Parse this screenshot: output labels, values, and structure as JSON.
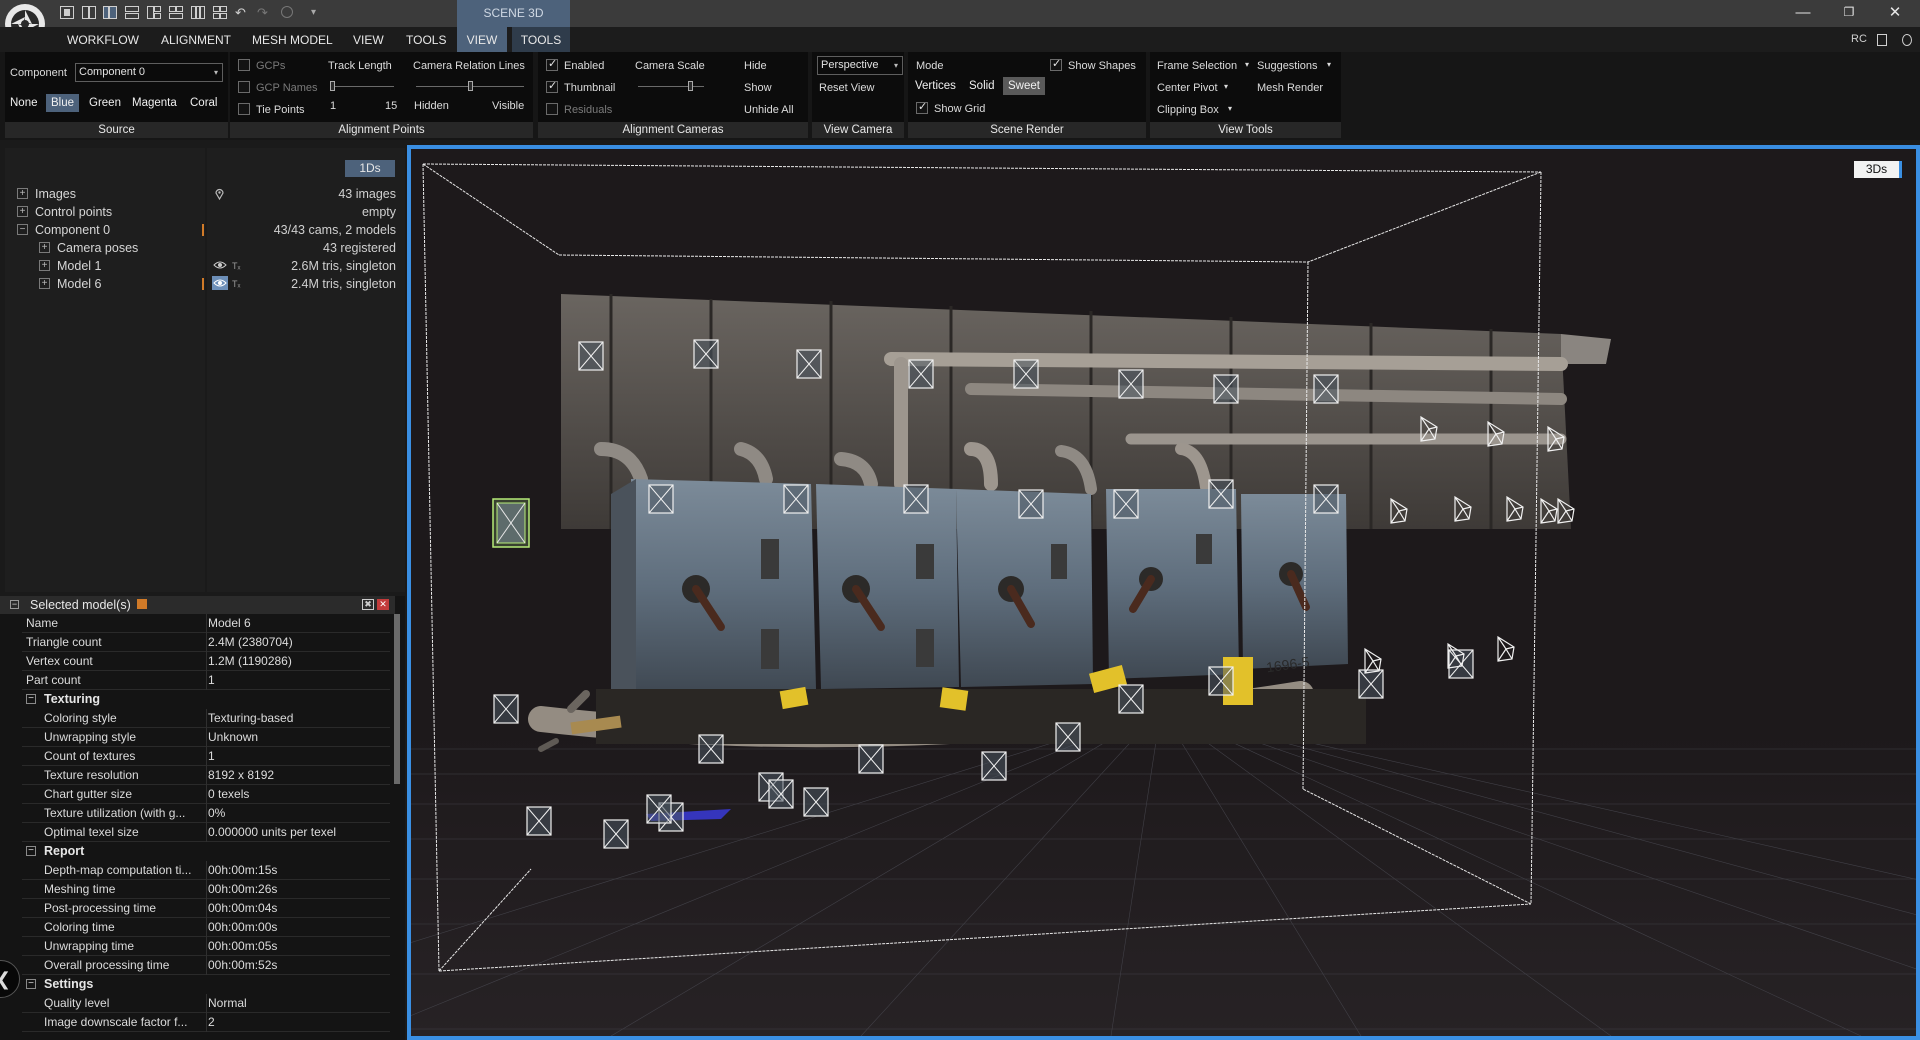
{
  "titlebar": {
    "scene_tab": "SCENE 3D",
    "minimize": "—",
    "restore": "❐",
    "close": "✕"
  },
  "menu": {
    "items": [
      "WORKFLOW",
      "ALIGNMENT",
      "MESH MODEL",
      "VIEW",
      "TOOLS"
    ],
    "active_tabs": [
      "VIEW",
      "TOOLS"
    ],
    "right_label": "RC"
  },
  "ribbon": {
    "source": {
      "component_label": "Component",
      "component_value": "Component 0",
      "colors": [
        "None",
        "Blue",
        "Green",
        "Magenta",
        "Coral"
      ],
      "selected_color": "Blue",
      "footer": "Source"
    },
    "alignment_points": {
      "gcps": "GCPs",
      "gcp_names": "GCP Names",
      "tie_points": "Tie Points",
      "track_length": "Track Length",
      "track_min": "1",
      "track_max": "15",
      "relation_lines": "Camera Relation Lines",
      "hidden": "Hidden",
      "visible": "Visible",
      "footer": "Alignment Points"
    },
    "alignment_cameras": {
      "enabled": "Enabled",
      "thumbnail": "Thumbnail",
      "residuals": "Residuals",
      "camera_scale": "Camera Scale",
      "hide": "Hide",
      "show": "Show",
      "unhide_all": "Unhide All",
      "footer": "Alignment Cameras"
    },
    "view_camera": {
      "projection": "Perspective",
      "reset_view": "Reset View",
      "footer": "View Camera"
    },
    "scene_render": {
      "mode": "Mode",
      "show_shapes": "Show Shapes",
      "modes": [
        "Vertices",
        "Solid",
        "Sweet"
      ],
      "selected_mode": "Sweet",
      "show_grid": "Show Grid",
      "footer": "Scene Render"
    },
    "view_tools": {
      "frame_selection": "Frame Selection",
      "suggestions": "Suggestions",
      "center_pivot": "Center Pivot",
      "mesh_render": "Mesh Render",
      "clipping_box": "Clipping Box",
      "footer": "View Tools"
    }
  },
  "tree": {
    "button_1ds": "1Ds",
    "rows": [
      {
        "label": "Images",
        "info": "43 images"
      },
      {
        "label": "Control points",
        "info": "empty"
      },
      {
        "label": "Component 0",
        "info": "43/43 cams, 2 models"
      },
      {
        "label": "Camera poses",
        "info": "43 registered"
      },
      {
        "label": "Model 1",
        "info": "2.6M tris, singleton"
      },
      {
        "label": "Model 6",
        "info": "2.4M tris, singleton"
      }
    ],
    "model_tag": "Tₓ"
  },
  "properties": {
    "title": "Selected model(s)",
    "rows": [
      {
        "k": "Name",
        "v": "Model 6"
      },
      {
        "k": "Triangle count",
        "v": "2.4M (2380704)"
      },
      {
        "k": "Vertex count",
        "v": "1.2M (1190286)"
      },
      {
        "k": "Part count",
        "v": "1"
      }
    ],
    "texturing_title": "Texturing",
    "texturing": [
      {
        "k": "Coloring style",
        "v": "Texturing-based"
      },
      {
        "k": "Unwrapping style",
        "v": "Unknown"
      },
      {
        "k": "Count of textures",
        "v": "1"
      },
      {
        "k": "Texture resolution",
        "v": "8192 x 8192"
      },
      {
        "k": "Chart gutter size",
        "v": "0 texels"
      },
      {
        "k": "Texture utilization (with g...",
        "v": "0%"
      },
      {
        "k": "Optimal texel size",
        "v": "0.000000 units per texel"
      }
    ],
    "report_title": "Report",
    "report": [
      {
        "k": "Depth-map computation ti...",
        "v": "00h:00m:15s"
      },
      {
        "k": "Meshing time",
        "v": "00h:00m:26s"
      },
      {
        "k": "Post-processing time",
        "v": "00h:00m:04s"
      },
      {
        "k": "Coloring time",
        "v": "00h:00m:00s"
      },
      {
        "k": "Unwrapping time",
        "v": "00h:00m:05s"
      },
      {
        "k": "Overall processing time",
        "v": "00h:00m:52s"
      }
    ],
    "settings_title": "Settings",
    "settings": [
      {
        "k": "Quality level",
        "v": "Normal"
      },
      {
        "k": "Image downscale factor f...",
        "v": "2"
      }
    ]
  },
  "viewport": {
    "button_3ds": "3Ds",
    "model_labels": [
      "1696-5"
    ],
    "colors": {
      "accent": "#3a8fe3",
      "selected_camera": "#a8e06a",
      "tab_active": "#4d627b"
    }
  }
}
